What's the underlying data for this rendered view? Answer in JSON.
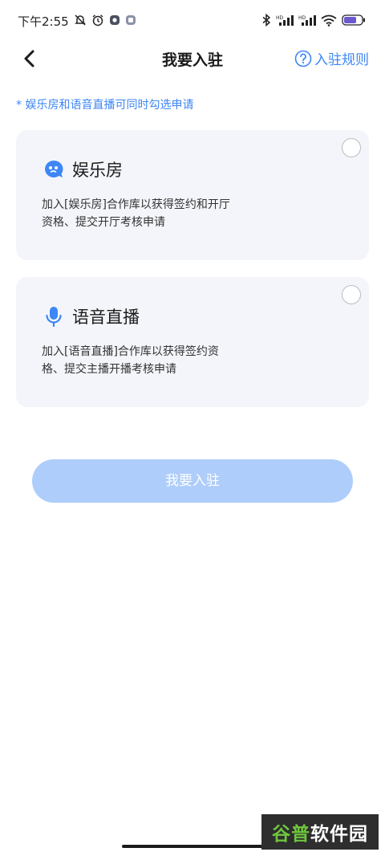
{
  "status_bar": {
    "time": "下午2:55",
    "left_icons": [
      "bell-off-icon",
      "alarm-icon",
      "app-icon",
      "app-icon-2"
    ],
    "right_icons": [
      "bluetooth-icon",
      "signal-icon",
      "signal-icon-2",
      "wifi-icon",
      "battery-icon"
    ]
  },
  "nav": {
    "title": "我要入驻",
    "rules_label": "入驻规则"
  },
  "hint": "* 娱乐房和语音直播可同时勾选申请",
  "options": [
    {
      "title": "娱乐房",
      "description": "加入[娱乐房]合作库以获得签约和开厅资格、提交开厅考核申请",
      "icon": "chat-bubble-icon",
      "selected": false
    },
    {
      "title": "语音直播",
      "description": "加入[语音直播]合作库以获得签约资格、提交主播开播考核申请",
      "icon": "microphone-icon",
      "selected": false
    }
  ],
  "submit_label": "我要入驻",
  "watermark": {
    "part1": "谷普",
    "part2": "软件园"
  },
  "colors": {
    "accent": "#3d86f5",
    "card_bg": "#f4f5fa",
    "button_disabled": "#aecdfb"
  }
}
